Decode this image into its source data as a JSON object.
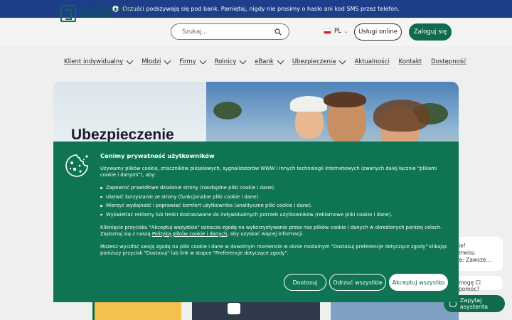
{
  "alert": {
    "text": "Oszuści podszywają się pod bank. Pamiętaj, nigdy nie prosimy o hasło ani kod SMS przez telefon."
  },
  "logo": {
    "line1": "BANK SPÓŁDZIELCZY",
    "line2": "W SZCZYTNIE"
  },
  "search": {
    "placeholder": "Szukaj..."
  },
  "lang": {
    "code": "PL"
  },
  "header": {
    "online_label": "Usługi online",
    "login_label": "Zaloguj się"
  },
  "nav": {
    "items": [
      {
        "label": "Klient indywidualny",
        "dropdown": true
      },
      {
        "label": "Młodzi",
        "dropdown": true
      },
      {
        "label": "Firmy",
        "dropdown": true
      },
      {
        "label": "Rolnicy",
        "dropdown": true
      },
      {
        "label": "eBank",
        "dropdown": true
      },
      {
        "label": "Ubezpieczenia",
        "dropdown": true
      },
      {
        "label": "Aktualności",
        "dropdown": false
      },
      {
        "label": "Kontakt",
        "dropdown": false
      },
      {
        "label": "Dostępność",
        "dropdown": false
      }
    ]
  },
  "hero": {
    "title": "Ubezpieczenie"
  },
  "cookie": {
    "title": "Cenimy prywatność użytkowników",
    "intro": "Używamy plików cookie, znaczników pikselowych, sygnalizatorów WWW i innych technologii internetowych (zwanych dalej łącznie \"plikami cookie i danymi\"), aby:",
    "items": [
      "Zapewnić prawidłowe działanie strony (niezbędne pliki cookie i dane).",
      "Ułatwić korzystanie ze strony (funkcjonalne pliki cookie i dane).",
      "Mierzyć wydajność i poprawiać komfort użytkownika (analityczne pliki cookie i dane).",
      "Wyświetlać reklamy lub treści dostosowane do indywidualnych potrzeb użytkowników (reklamowe pliki cookie i dane)."
    ],
    "accept_info_before": "Kliknięcie przycisku \"Akceptuj wszystkie\" oznacza zgodę na wykorzystywanie przez nas plików cookie i danych w określonych poniżej celach. Zapoznaj się z naszą",
    "policy_link": "Polityką plików cookie i danych",
    "accept_info_after": ", aby uzyskać więcej informacji.",
    "withdraw_info": "Możesz wycofać swoją zgodę na pliki cookie i dane w dowolnym momencie w oknie modalnym \"Dostosuj preferencje dotyczące zgody\" klikając poniższy przycisk \"Dostosuj\" lub link w stopce \"Preferencje dotyczące zgody\".",
    "btn_customize": "Dostosuj",
    "btn_reject": "Odrzuć wszystkie",
    "btn_accept": "Akceptuj wszystko"
  },
  "chat": {
    "greeting_l1": "ytnie!",
    "greeting_l2": "z serwisu",
    "greeting_l3": "ącze: Zawsze...",
    "question": "mogę Ci pomóc?",
    "assistant_label": "Zapytaj asystenta"
  },
  "colors": {
    "brand_green": "#0f6a4e",
    "cookie_bg": "#0f7453",
    "alert_blue": "#1d3f8a"
  }
}
